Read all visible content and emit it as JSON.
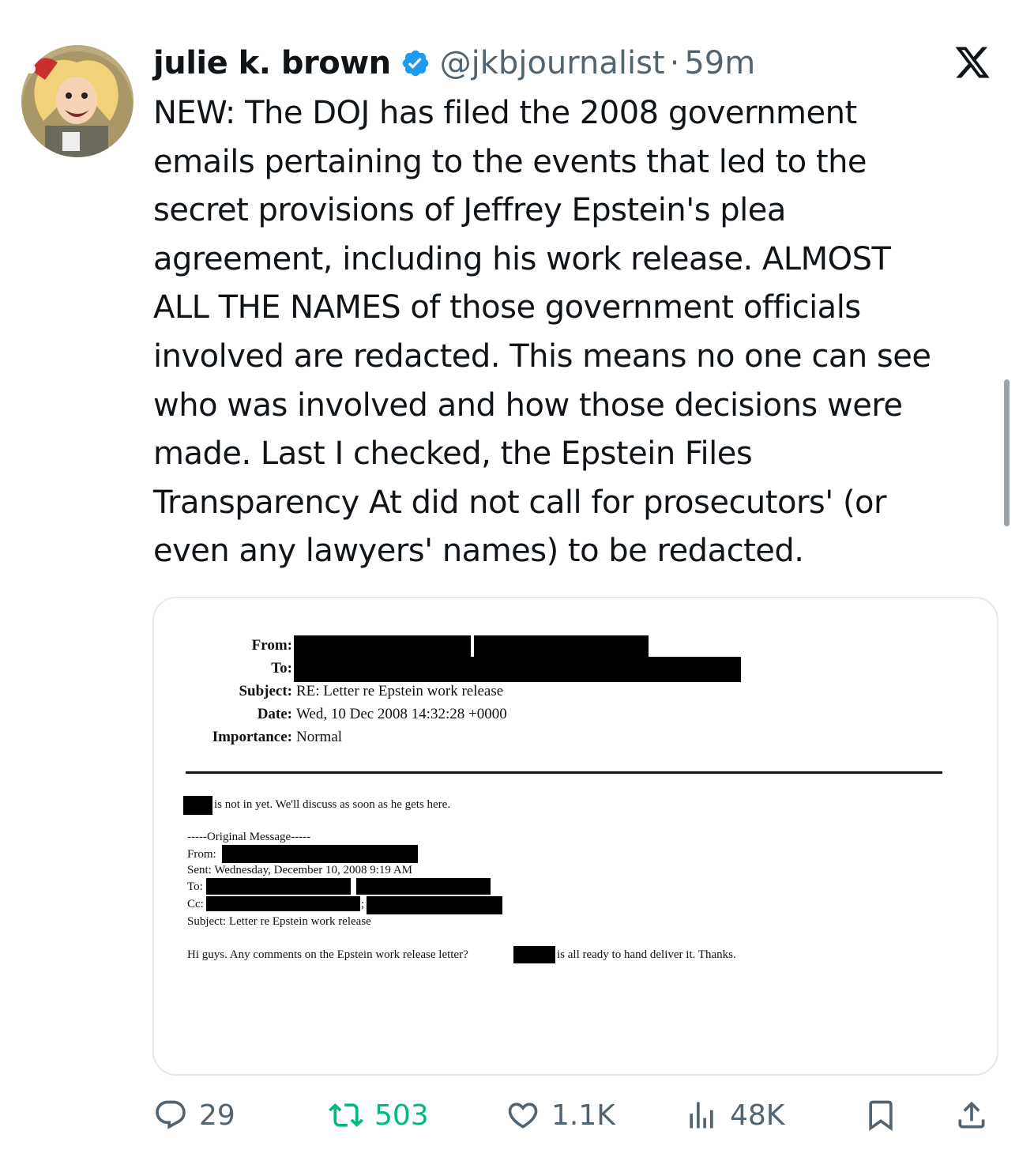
{
  "tweet": {
    "author_name": "julie k. brown",
    "handle": "@jkbjournalist",
    "separator": "·",
    "time": "59m",
    "text": "NEW: The DOJ has filed the 2008 government\nemails pertaining to the events that led to the\nsecret provisions of Jeffrey Epstein's plea\nagreement, including his work release.  ALMOST\nALL THE NAMES of those government officials\ninvolved are redacted. This means no one can see\nwho was involved and how those decisions were\nmade. Last I checked, the Epstein Files\nTransparency At did not call for prosecutors' (or\neven any lawyers' names) to be redacted."
  },
  "icons": {
    "verified": "verified-badge-icon",
    "close": "x-logo-icon",
    "reply": "reply-icon",
    "retweet": "retweet-icon",
    "like": "heart-icon",
    "views": "views-chart-icon",
    "bookmark": "bookmark-icon",
    "share": "share-icon"
  },
  "colors": {
    "verified": "#1d9bf0",
    "retweet_active": "#00ba7c",
    "muted": "#536471"
  },
  "document": {
    "from_label": "From:",
    "to_label": "To:",
    "subject_label": "Subject:",
    "subject_value": "RE: Letter re Epstein work release",
    "date_label": "Date:",
    "date_value": "Wed, 10 Dec 2008 14:32:28 +0000",
    "importance_label": "Importance:",
    "importance_value": "Normal",
    "body_line": "is not in yet. We'll discuss as soon as he gets here.",
    "original_message": "-----Original Message-----",
    "orig_from": "From:",
    "orig_sent": "Sent: Wednesday, December 10, 2008 9:19 AM",
    "orig_to": "To:",
    "orig_cc": "Cc:",
    "orig_semicolon": ";",
    "orig_subject": "Subject: Letter re Epstein work release",
    "closing_before": "Hi guys. Any comments on the Epstein work release letter?",
    "closing_after": "is all ready to hand deliver it. Thanks."
  },
  "actions": {
    "replies": "29",
    "retweets": "503",
    "likes": "1.1K",
    "views": "48K"
  }
}
